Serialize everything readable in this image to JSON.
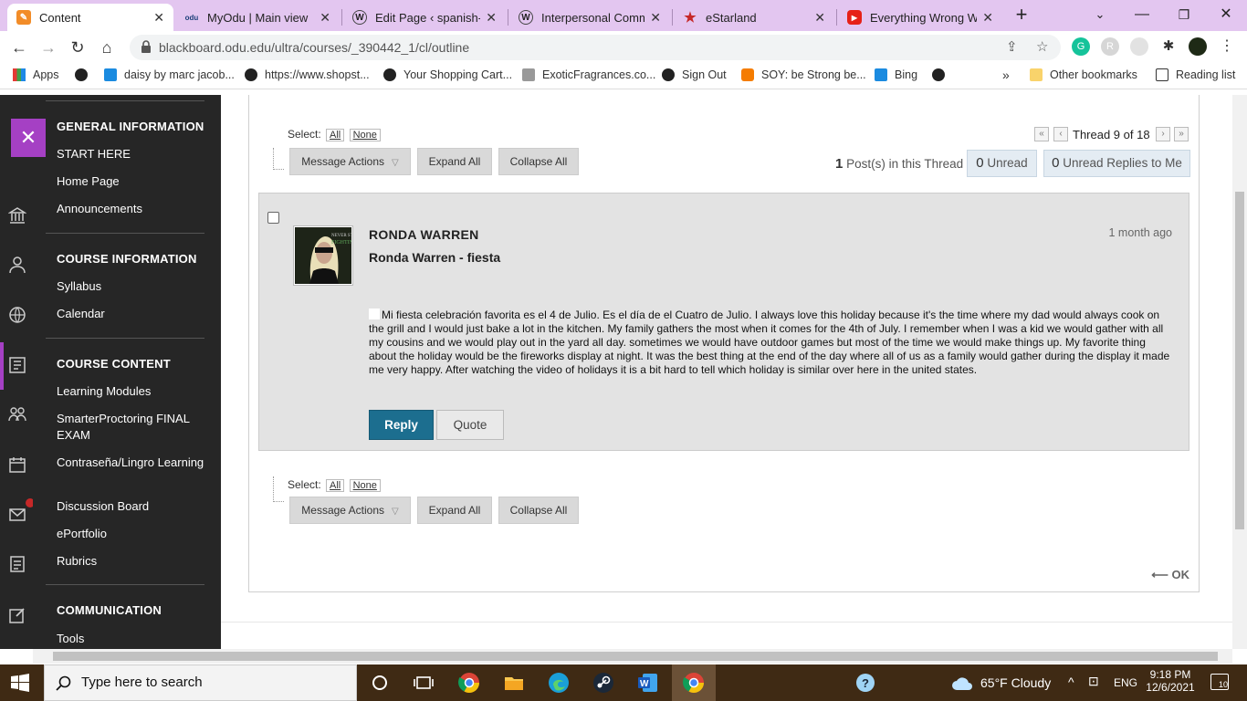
{
  "browser": {
    "tabs": [
      {
        "label": "Content",
        "icon": "blackboard-icon",
        "active": true
      },
      {
        "label": "MyOdu | Main view",
        "icon": "odu-icon"
      },
      {
        "label": "Edit Page ‹ spanish-pc",
        "icon": "wordpress-icon"
      },
      {
        "label": "Interpersonal Commu",
        "icon": "wordpress-icon"
      },
      {
        "label": "eStarland",
        "icon": "star-icon"
      },
      {
        "label": "Everything Wrong Wit",
        "icon": "youtube-icon"
      }
    ],
    "new_tab": "+",
    "url": "blackboard.odu.edu/ultra/courses/_390442_1/cl/outline",
    "bookmarks": [
      {
        "label": "Apps"
      },
      {
        "label": "daisy by marc jacob..."
      },
      {
        "label": "https://www.shopst..."
      },
      {
        "label": "Your Shopping Cart..."
      },
      {
        "label": "ExoticFragrances.co..."
      },
      {
        "label": "Sign Out"
      },
      {
        "label": "SOY: be Strong be..."
      },
      {
        "label": "Bing"
      }
    ],
    "other_bookmarks": "Other bookmarks",
    "reading_list": "Reading list",
    "overflow": "»"
  },
  "sidebar": {
    "sections": [
      {
        "heading": "GENERAL INFORMATION",
        "items": [
          "START HERE",
          "Home Page",
          "Announcements"
        ]
      },
      {
        "heading": "COURSE INFORMATION",
        "items": [
          "Syllabus",
          "Calendar"
        ]
      },
      {
        "heading": "COURSE CONTENT",
        "items": [
          "Learning Modules",
          "SmarterProctoring FINAL EXAM",
          "Contraseña/Lingro Learning",
          "Discussion Board",
          "ePortfolio",
          "Rubrics"
        ]
      },
      {
        "heading": "COMMUNICATION",
        "items": [
          "Tools"
        ]
      }
    ]
  },
  "thread": {
    "select_label": "Select:",
    "select_all": "All",
    "select_none": "None",
    "message_actions": "Message Actions",
    "expand_all": "Expand All",
    "collapse_all": "Collapse All",
    "pager": "Thread 9 of 18",
    "posts_count": "1",
    "posts_label": "Post(s) in this Thread",
    "unread_count": "0",
    "unread_label": "Unread",
    "unread_replies_count": "0",
    "unread_replies_label": "Unread Replies to Me",
    "ok_label": "⟵ OK"
  },
  "post": {
    "author": "RONDA WARREN",
    "subject": "Ronda Warren - fiesta",
    "time": "1 month ago",
    "body": "Mi fiesta celebración favorita es el 4 de Julio. Es el día de el Cuatro de Julio. I always love this holiday because it's the time where my dad would always cook on the grill and I would just bake a lot in the kitchen. My family gathers the most when it comes for the 4th of July. I remember when I was a kid we would gather with all my cousins and we would play out in the yard all day. sometimes we would have outdoor games but most of the time we would make things up. My favorite thing about the holiday would be the fireworks display at night. It was the best thing at the end of the day where all of us as a family would gather during the display it made me very happy.  After watching the video of holidays it is a bit hard to tell which holiday is similar over here in the united states.",
    "reply": "Reply",
    "quote": "Quote",
    "avatar_text": "NEVER STO FIGHTIN"
  },
  "taskbar": {
    "search_placeholder": "Type here to search",
    "weather": "65°F  Cloudy",
    "lang": "ENG",
    "time": "9:18 PM",
    "date": "12/6/2021",
    "notifications": "10"
  },
  "colors": {
    "accent_purple": "#a540c4",
    "reply_blue": "#1c6e8f",
    "tab_bar": "#e3c6f0",
    "sidebar_bg": "#262626"
  }
}
